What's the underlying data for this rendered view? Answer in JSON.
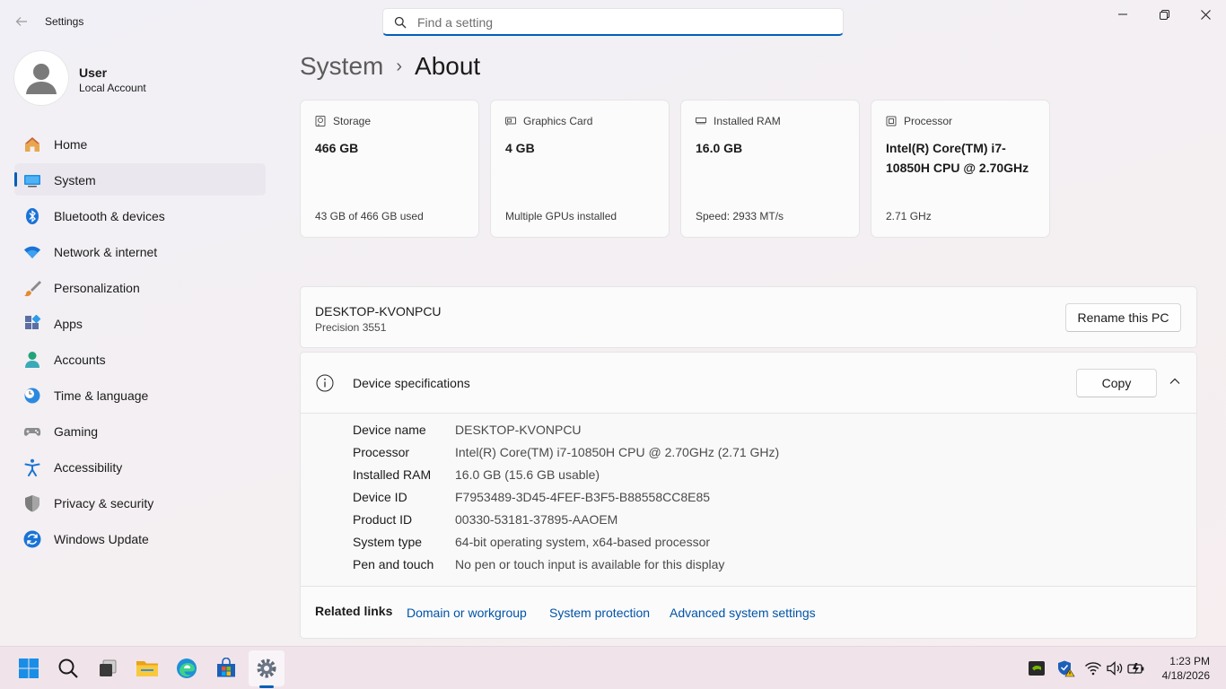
{
  "window": {
    "title": "Settings",
    "search_placeholder": "Find a setting"
  },
  "profile": {
    "name": "User",
    "account_type": "Local Account"
  },
  "sidebar": {
    "items": [
      {
        "label": "Home",
        "icon": "home-icon"
      },
      {
        "label": "System",
        "icon": "system-icon",
        "active": true
      },
      {
        "label": "Bluetooth & devices",
        "icon": "bluetooth-icon"
      },
      {
        "label": "Network & internet",
        "icon": "network-icon"
      },
      {
        "label": "Personalization",
        "icon": "brush-icon"
      },
      {
        "label": "Apps",
        "icon": "apps-icon"
      },
      {
        "label": "Accounts",
        "icon": "accounts-icon"
      },
      {
        "label": "Time & language",
        "icon": "clock-globe-icon"
      },
      {
        "label": "Gaming",
        "icon": "gamepad-icon"
      },
      {
        "label": "Accessibility",
        "icon": "accessibility-icon"
      },
      {
        "label": "Privacy & security",
        "icon": "shield-icon"
      },
      {
        "label": "Windows Update",
        "icon": "update-icon"
      }
    ]
  },
  "breadcrumb": {
    "parent": "System",
    "separator": "›",
    "current": "About"
  },
  "cards": [
    {
      "label": "Storage",
      "value": "466 GB",
      "sub": "43 GB of 466 GB used",
      "icon": "storage-icon"
    },
    {
      "label": "Graphics Card",
      "value": "4 GB",
      "sub": "Multiple GPUs installed",
      "icon": "graphics-card-icon"
    },
    {
      "label": "Installed RAM",
      "value": "16.0 GB",
      "sub": "Speed: 2933 MT/s",
      "icon": "ram-icon"
    },
    {
      "label": "Processor",
      "value": "Intel(R) Core(TM) i7-10850H CPU @ 2.70GHz",
      "sub": "2.71 GHz",
      "icon": "processor-icon"
    }
  ],
  "pc": {
    "name": "DESKTOP-KVONPCU",
    "model": "Precision 3551",
    "rename_label": "Rename this PC"
  },
  "specs": {
    "title": "Device specifications",
    "copy_label": "Copy",
    "rows": [
      {
        "key": "Device name",
        "value": "DESKTOP-KVONPCU"
      },
      {
        "key": "Processor",
        "value": "Intel(R) Core(TM) i7-10850H CPU @ 2.70GHz (2.71 GHz)"
      },
      {
        "key": "Installed RAM",
        "value": "16.0 GB (15.6 GB usable)"
      },
      {
        "key": "Device ID",
        "value": "F7953489-3D45-4FEF-B3F5-B88558CC8E85"
      },
      {
        "key": "Product ID",
        "value": "00330-53181-37895-AAOEM"
      },
      {
        "key": "System type",
        "value": "64-bit operating system, x64-based processor"
      },
      {
        "key": "Pen and touch",
        "value": "No pen or touch input is available for this display"
      }
    ]
  },
  "related": {
    "label": "Related links",
    "links": [
      "Domain or workgroup",
      "System protection",
      "Advanced system settings"
    ]
  },
  "taskbar": {
    "apps": [
      "start-icon",
      "search-icon",
      "task-view-icon",
      "file-explorer-icon",
      "edge-icon",
      "store-icon",
      "settings-icon"
    ],
    "tray": [
      "nvidia-icon",
      "security-warning-icon",
      "wifi-icon",
      "volume-icon",
      "battery-icon"
    ],
    "time": "1:23 PM",
    "date": "4/18/2026"
  },
  "colors": {
    "accent": "#005fb8",
    "link": "#0053a8"
  }
}
